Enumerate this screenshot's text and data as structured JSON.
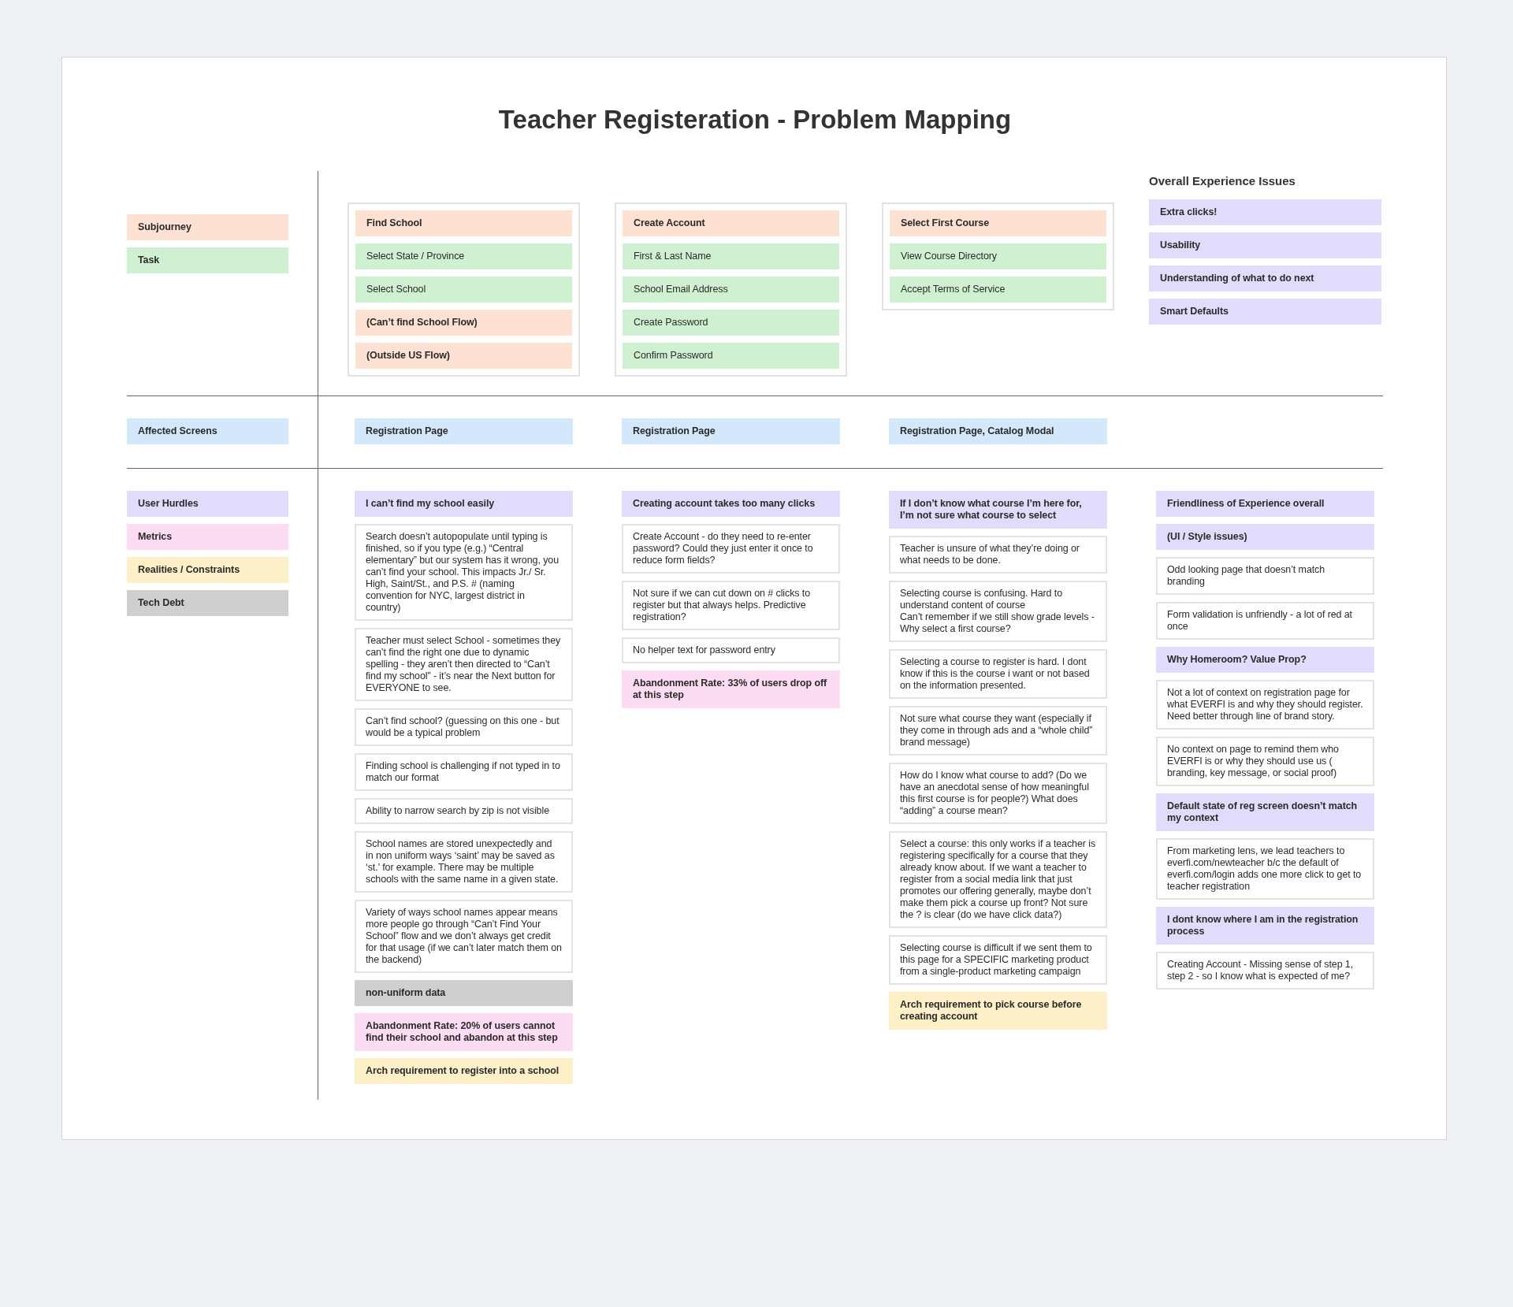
{
  "title": "Teacher Registeration - Problem Mapping",
  "legend_top": [
    {
      "kind": "subjourney",
      "label": "Subjourney"
    },
    {
      "kind": "task",
      "label": "Task"
    }
  ],
  "journeys": [
    {
      "items": [
        {
          "kind": "subjourney",
          "text": "Find School"
        },
        {
          "kind": "task",
          "text": "Select State / Province"
        },
        {
          "kind": "task",
          "text": "Select School"
        },
        {
          "kind": "subjourney",
          "text": "(Can’t find School Flow)"
        },
        {
          "kind": "subjourney",
          "text": "(Outside US Flow)"
        }
      ]
    },
    {
      "items": [
        {
          "kind": "subjourney",
          "text": "Create Account"
        },
        {
          "kind": "task",
          "text": "First & Last Name"
        },
        {
          "kind": "task",
          "text": "School Email Address"
        },
        {
          "kind": "task",
          "text": "Create Password"
        },
        {
          "kind": "task",
          "text": "Confirm Password"
        }
      ]
    },
    {
      "items": [
        {
          "kind": "subjourney",
          "text": "Select First Course"
        },
        {
          "kind": "task",
          "text": "View Course Directory"
        },
        {
          "kind": "task",
          "text": "Accept Terms of Service"
        }
      ]
    }
  ],
  "overall": {
    "heading": "Overall Experience Issues",
    "items": [
      {
        "kind": "hurdle",
        "text": "Extra clicks!"
      },
      {
        "kind": "hurdle",
        "text": "Usability"
      },
      {
        "kind": "hurdle",
        "text": "Understanding of what to do next"
      },
      {
        "kind": "hurdle",
        "text": "Smart Defaults"
      }
    ]
  },
  "legend_screens": [
    {
      "kind": "screen",
      "label": "Affected Screens"
    }
  ],
  "screens": [
    {
      "kind": "screen",
      "text": "Registration Page"
    },
    {
      "kind": "screen",
      "text": "Registration Page"
    },
    {
      "kind": "screen",
      "text": "Registration Page, Catalog Modal"
    }
  ],
  "legend_bottom": [
    {
      "kind": "hurdle",
      "label": "User Hurdles"
    },
    {
      "kind": "metric",
      "label": "Metrics"
    },
    {
      "kind": "constraint",
      "label": "Realities / Constraints"
    },
    {
      "kind": "techdebt",
      "label": "Tech Debt"
    }
  ],
  "columns": [
    [
      {
        "kind": "hurdle",
        "text": "I can’t find my school easily"
      },
      {
        "kind": "note",
        "text": "Search doesn’t autopopulate until typing is finished, so if you type (e.g.) “Central elementary” but our system has it wrong, you can’t find your school. This impacts Jr./ Sr. High, Saint/St., and P.S. # (naming convention for NYC, largest district in country)"
      },
      {
        "kind": "note",
        "text": "Teacher must select School - sometimes they can’t find the right one due to dynamic spelling - they aren’t then directed to “Can’t find my school” - it’s near the Next button for EVERYONE to see."
      },
      {
        "kind": "note",
        "text": "Can’t find school? (guessing on this one - but would be a typical problem"
      },
      {
        "kind": "note",
        "text": "Finding school is challenging if not typed in to match our format"
      },
      {
        "kind": "note",
        "text": "Ability to narrow search by zip is not visible"
      },
      {
        "kind": "note",
        "text": "School names are stored unexpectedly and in non uniform ways ‘saint’ may be saved as ‘st.’ for example.  There may be multiple schools with the same name in a given state."
      },
      {
        "kind": "note",
        "text": "Variety of ways school names appear means more people go through “Can’t Find Your School” flow and we don’t always get credit for that usage (if we can’t later match them on the backend)"
      },
      {
        "kind": "techdebt",
        "text": "non-uniform data"
      },
      {
        "kind": "metric",
        "text": "Abandonment Rate: 20% of users cannot find their school and abandon at this step"
      },
      {
        "kind": "constraint",
        "text": "Arch requirement to register into a school"
      }
    ],
    [
      {
        "kind": "hurdle",
        "text": "Creating account takes too many clicks"
      },
      {
        "kind": "note",
        "text": "Create Account - do they need to re-enter password? Could they just enter it once to reduce form fields?"
      },
      {
        "kind": "note",
        "text": "Not sure if we can cut down on # clicks to register but that always helps. Predictive registration?"
      },
      {
        "kind": "note",
        "text": "No helper text for password entry"
      },
      {
        "kind": "metric",
        "text": "Abandonment Rate: 33% of users drop off at this step"
      }
    ],
    [
      {
        "kind": "hurdle",
        "text": "If I don’t know what course I’m here for, I’m not sure what course to select"
      },
      {
        "kind": "note",
        "text": "Teacher is unsure of what they’re doing or what needs to be done."
      },
      {
        "kind": "note",
        "text": "Selecting course is confusing. Hard to understand content of course\nCan’t remember if we still show grade levels - Why select a first course?"
      },
      {
        "kind": "note",
        "text": "Selecting a course to register is hard. I dont know if this is the course i want or not based on the information presented."
      },
      {
        "kind": "note",
        "text": "Not sure what course they want (especially if they come in through ads and a “whole child” brand message)"
      },
      {
        "kind": "note",
        "text": "How do I know what course to add? (Do we have an anecdotal sense of how meaningful this first course is for people?) What does “adding” a course mean?"
      },
      {
        "kind": "note",
        "text": "Select a course:  this only works if a teacher is registering specifically for a course that they already know about.  If we want a teacher to register from a social media link that just promotes our offering generally, maybe don’t make them pick a course up front? Not sure the ? is clear (do we have click data?)"
      },
      {
        "kind": "note",
        "text": "Selecting course is difficult if we sent them to this page for a SPECIFIC marketing product from a single-product marketing campaign"
      },
      {
        "kind": "constraint",
        "text": "Arch requirement to pick course before creating account"
      }
    ],
    [
      {
        "kind": "hurdle",
        "text": "Friendliness of Experience overall"
      },
      {
        "kind": "hurdle",
        "text": "(UI / Style issues)"
      },
      {
        "kind": "note",
        "text": "Odd looking page that doesn’t match branding"
      },
      {
        "kind": "note",
        "text": "Form validation is unfriendly - a lot of red at once"
      },
      {
        "kind": "hurdle",
        "text": "Why Homeroom? Value Prop?"
      },
      {
        "kind": "note",
        "text": "Not a lot of context on registration page for what EVERFI is and why they should register. Need better through line of brand story."
      },
      {
        "kind": "note",
        "text": "No context on page to remind them who EVERFI is or why they should use us ( branding, key message, or social proof)"
      },
      {
        "kind": "hurdle",
        "text": "Default state of reg screen doesn’t match my context"
      },
      {
        "kind": "note",
        "text": "From marketing lens, we lead teachers to everfi.com/newteacher b/c the default of everfi.com/login adds one more click to get to teacher registration"
      },
      {
        "kind": "hurdle",
        "text": "I dont know where I am in the registration process"
      },
      {
        "kind": "note",
        "text": "Creating Account - Missing sense of step 1, step 2 - so I know what is expected of me?"
      }
    ]
  ]
}
